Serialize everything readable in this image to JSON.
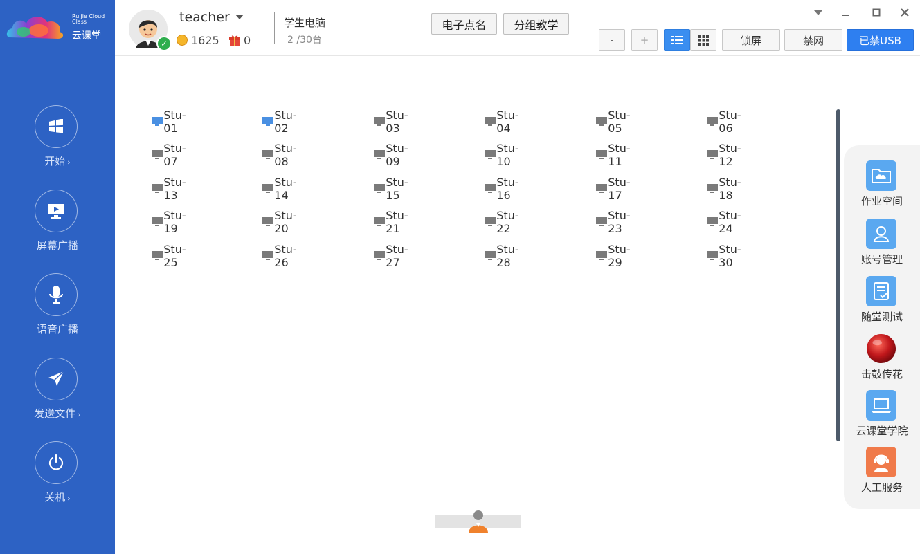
{
  "brand": {
    "small": "Ruijie Cloud Class",
    "name": "云课堂"
  },
  "sidebar": {
    "items": [
      {
        "label": "开始",
        "arrow": "›",
        "icon": "windows-icon"
      },
      {
        "label": "屏幕广播",
        "arrow": "",
        "icon": "screen-broadcast-icon"
      },
      {
        "label": "语音广播",
        "arrow": "",
        "icon": "microphone-icon"
      },
      {
        "label": "发送文件",
        "arrow": "›",
        "icon": "send-icon"
      },
      {
        "label": "关机",
        "arrow": "›",
        "icon": "power-icon"
      }
    ]
  },
  "header": {
    "user": {
      "name": "teacher",
      "coins": "1625",
      "gifts": "0"
    },
    "pc": {
      "title": "学生电脑",
      "count": "2 /30台"
    },
    "roll_call": "电子点名",
    "group_teach": "分组教学",
    "zoom_out": "-",
    "zoom_in": "+",
    "lock_screen": "锁屏",
    "ban_net": "禁网",
    "usb": "已禁USB"
  },
  "students": {
    "online_color": "#4a90e2",
    "offline_color": "#7a7a7a",
    "list": [
      {
        "name": "Stu-01",
        "online": true
      },
      {
        "name": "Stu-02",
        "online": true
      },
      {
        "name": "Stu-03",
        "online": false
      },
      {
        "name": "Stu-04",
        "online": false
      },
      {
        "name": "Stu-05",
        "online": false
      },
      {
        "name": "Stu-06",
        "online": false
      },
      {
        "name": "Stu-07",
        "online": false
      },
      {
        "name": "Stu-08",
        "online": false
      },
      {
        "name": "Stu-09",
        "online": false
      },
      {
        "name": "Stu-10",
        "online": false
      },
      {
        "name": "Stu-11",
        "online": false
      },
      {
        "name": "Stu-12",
        "online": false
      },
      {
        "name": "Stu-13",
        "online": false
      },
      {
        "name": "Stu-14",
        "online": false
      },
      {
        "name": "Stu-15",
        "online": false
      },
      {
        "name": "Stu-16",
        "online": false
      },
      {
        "name": "Stu-17",
        "online": false
      },
      {
        "name": "Stu-18",
        "online": false
      },
      {
        "name": "Stu-19",
        "online": false
      },
      {
        "name": "Stu-20",
        "online": false
      },
      {
        "name": "Stu-21",
        "online": false
      },
      {
        "name": "Stu-22",
        "online": false
      },
      {
        "name": "Stu-23",
        "online": false
      },
      {
        "name": "Stu-24",
        "online": false
      },
      {
        "name": "Stu-25",
        "online": false
      },
      {
        "name": "Stu-26",
        "online": false
      },
      {
        "name": "Stu-27",
        "online": false
      },
      {
        "name": "Stu-28",
        "online": false
      },
      {
        "name": "Stu-29",
        "online": false
      },
      {
        "name": "Stu-30",
        "online": false
      }
    ]
  },
  "tools": [
    {
      "label": "作业空间",
      "icon": "homework-folder-icon",
      "color": "#5aa8f0"
    },
    {
      "label": "账号管理",
      "icon": "account-icon",
      "color": "#5aa8f0"
    },
    {
      "label": "随堂测试",
      "icon": "quiz-icon",
      "color": "#5aa8f0"
    },
    {
      "label": "击鼓传花",
      "icon": "red-ball-icon",
      "color": "#c0171b"
    },
    {
      "label": "云课堂学院",
      "icon": "laptop-icon",
      "color": "#5aa8f0"
    },
    {
      "label": "人工服务",
      "icon": "support-agent-icon",
      "color": "#f07a4a"
    }
  ]
}
